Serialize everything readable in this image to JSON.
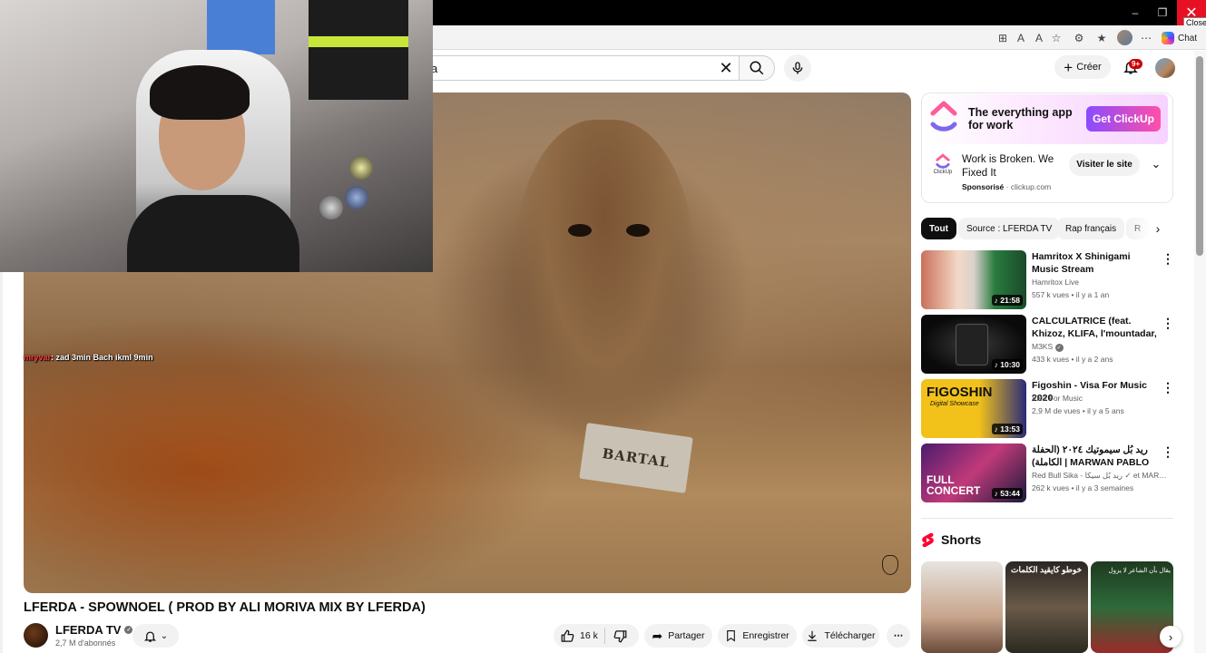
{
  "window": {
    "minimize": "–",
    "maximize": "❐",
    "close": "✕",
    "close_tooltip": "Close"
  },
  "browser": {
    "chat_label": "Chat"
  },
  "header": {
    "search_value": "a",
    "create_label": "Créer",
    "notification_count": "9+"
  },
  "video": {
    "overlay_chat_user": "mryvar",
    "overlay_chat_message": ": zad 3min Bach ikml 9min",
    "sign_text": "BARTAL",
    "title": "LFERDA - SPOWNOEL ( PROD BY ALI MORIVA MIX BY LFERDA)",
    "channel_name": "LFERDA TV",
    "subscribers": "2,7 M d'abonnés",
    "likes": "16 k",
    "share_label": "Partager",
    "save_label": "Enregistrer",
    "download_label": "Télécharger"
  },
  "ad": {
    "slogan": "The everything app for work",
    "banner_cta": "Get ClickUp",
    "brand": "ClickUp",
    "headline": "Work is Broken. We Fixed It",
    "sponsored": "Sponsorisé",
    "domain": "· clickup.com",
    "visit_label": "Visiter le site"
  },
  "chips": [
    "Tout",
    "Source : LFERDA TV",
    "Rap français",
    "R"
  ],
  "recommendations": [
    {
      "title": "Hamritox X Shinigami Music Stream",
      "channel": "Hamritox Live",
      "meta": "557 k vues • il y a 1 an",
      "duration": "21:58"
    },
    {
      "title": "CALCULATRICE (feat. Khizoz, KLIFA, l'mountadar, BIG ELY, ...",
      "channel": "M3KS",
      "meta": "433 k vues • il y a 2 ans",
      "duration": "10:30"
    },
    {
      "title": "Figoshin - Visa For Music 2020",
      "channel": "Visa For Music",
      "meta": "2,9 M de vues • il y a 5 ans",
      "duration": "13:53"
    },
    {
      "title": "ريد بُل سيموتيك ٢٠٢٤ (الحفلة الكاملة) | MARWAN PABLO",
      "channel": "Red Bull Sika - ريد بُل سيكا ✓ et MARWAN ...",
      "meta": "262 k vues • il y a 3 semaines",
      "duration": "53:44"
    }
  ],
  "thumb_text": {
    "figoshin": "FIGOSHIN",
    "figoshin_sub": "Digital Showcase",
    "concert_line1": "FULL",
    "concert_line2": "CONCERT"
  },
  "shorts": {
    "label": "Shorts",
    "short2_caption": "خوطو كايقيد الكلمات",
    "short3_caption": "يقال بأن الشاعر لا يزول"
  },
  "colors": {
    "accent_red": "#ff0000",
    "chip_active": "#0f0f0f",
    "badge": "#cc0000"
  }
}
